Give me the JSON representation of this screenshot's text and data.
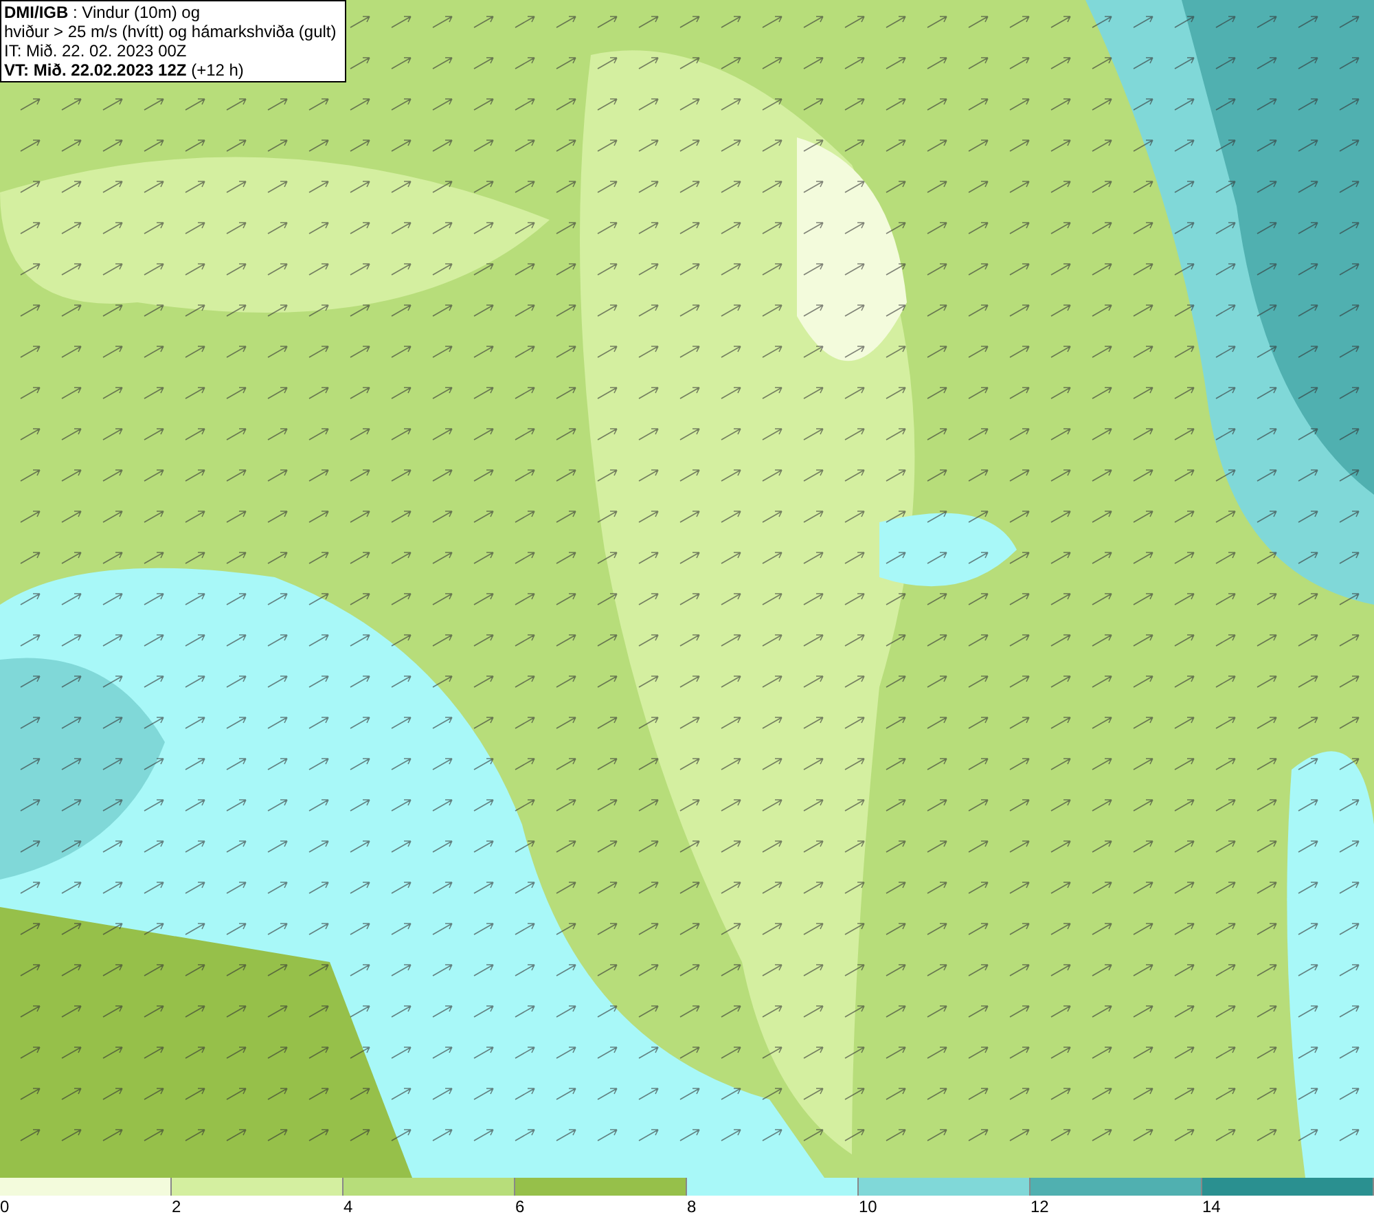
{
  "header": {
    "lines": [
      "**DMI/IGB** : Vindur (10m) og",
      "hviður > 25 m/s (hvítt) og hámarkshviða (gult)",
      "IT: Mið. 22. 02. 2023 00Z",
      "**VT: Mið. 22.02.2023 12Z** (+12 h)"
    ]
  },
  "legend": {
    "bins": [
      {
        "label": "0",
        "color": "#f3fbdc"
      },
      {
        "label": "2",
        "color": "#d4efa0"
      },
      {
        "label": "4",
        "color": "#b7dd7a"
      },
      {
        "label": "6",
        "color": "#96c04a"
      },
      {
        "label": "8",
        "color": "#a8f8f8"
      },
      {
        "label": "10",
        "color": "#80d8d8"
      },
      {
        "label": "12",
        "color": "#50b0b0"
      },
      {
        "label": "14",
        "color": "#2a9090"
      }
    ]
  }
}
